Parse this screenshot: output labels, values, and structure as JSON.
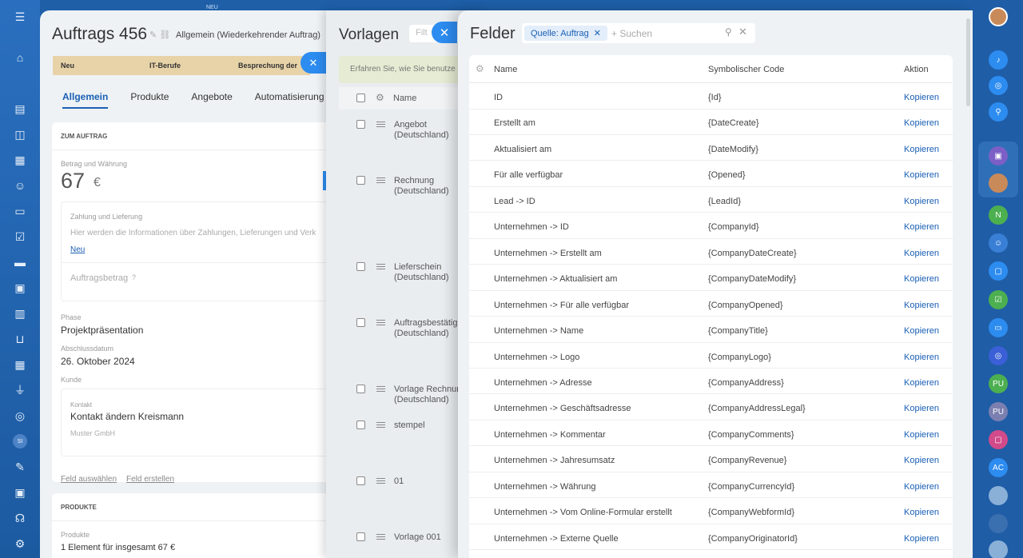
{
  "deal": {
    "title": "Auftrags 456",
    "subtitle": "Allgemein (Wiederkehrender Auftrag)",
    "stages": [
      "Neu",
      "IT-Berufe",
      "Besprechung der"
    ],
    "tabs": [
      "Allgemein",
      "Produkte",
      "Angebote",
      "Automatisierung"
    ],
    "section_title": "ZUM AUFTRAG",
    "amount_label": "Betrag und Währung",
    "amount": "67",
    "currency": "€",
    "payment_title": "Zahlung und Lieferung",
    "payment_text": "Hier werden die Informationen über Zahlungen, Lieferungen und Verk",
    "payment_link": "Neu",
    "order_amount_label": "Auftragsbetrag",
    "phase_label": "Phase",
    "phase_value": "Projektpräsentation",
    "close_date_label": "Abschlussdatum",
    "close_date_value": "26. Oktober 2024",
    "customer_label": "Kunde",
    "contact_label": "Kontakt",
    "contact_value": "Kontakt ändern Kreismann",
    "company_value": "Muster GmbH",
    "select_field": "Feld auswählen",
    "create_field": "Feld erstellen",
    "products_title": "PRODUKTE",
    "products_label": "Produkte",
    "products_value": "1 Element für insgesamt 67 €"
  },
  "templates": {
    "title": "Vorlagen",
    "filter_placeholder": "Filt",
    "info": "Erfahren Sie, wie Sie benutze",
    "name_header": "Name",
    "rows": [
      {
        "name": "Angebot\n(Deutschland)"
      },
      {
        "name": "Rechnung\n(Deutschland)"
      },
      {
        "name": "Lieferschein\n(Deutschland)"
      },
      {
        "name": "Auftragsbestätig\n(Deutschland)"
      },
      {
        "name": "Vorlage Rechnun\n(Deutschland)"
      },
      {
        "name": "stempel"
      },
      {
        "name": "01"
      },
      {
        "name": "Vorlage 001"
      }
    ]
  },
  "fields": {
    "title": "Felder",
    "chip": "Quelle: Auftrag",
    "search_placeholder": "+ Suchen",
    "headers": {
      "name": "Name",
      "code": "Symbolischer Code",
      "action": "Aktion"
    },
    "action_label": "Kopieren",
    "rows": [
      {
        "name": "ID",
        "code": "{Id}"
      },
      {
        "name": "Erstellt am",
        "code": "{DateCreate}"
      },
      {
        "name": "Aktualisiert am",
        "code": "{DateModify}"
      },
      {
        "name": "Für alle verfügbar",
        "code": "{Opened}"
      },
      {
        "name": "Lead -> ID",
        "code": "{LeadId}"
      },
      {
        "name": "Unternehmen -> ID",
        "code": "{CompanyId}"
      },
      {
        "name": "Unternehmen -> Erstellt am",
        "code": "{CompanyDateCreate}"
      },
      {
        "name": "Unternehmen -> Aktualisiert am",
        "code": "{CompanyDateModify}"
      },
      {
        "name": "Unternehmen -> Für alle verfügbar",
        "code": "{CompanyOpened}"
      },
      {
        "name": "Unternehmen -> Name",
        "code": "{CompanyTitle}"
      },
      {
        "name": "Unternehmen -> Logo",
        "code": "{CompanyLogo}"
      },
      {
        "name": "Unternehmen -> Adresse",
        "code": "{CompanyAddress}"
      },
      {
        "name": "Unternehmen -> Geschäftsadresse",
        "code": "{CompanyAddressLegal}"
      },
      {
        "name": "Unternehmen -> Kommentar",
        "code": "{CompanyComments}"
      },
      {
        "name": "Unternehmen -> Jahresumsatz",
        "code": "{CompanyRevenue}"
      },
      {
        "name": "Unternehmen -> Währung",
        "code": "{CompanyCurrencyId}"
      },
      {
        "name": "Unternehmen -> Vom Online-Formular erstellt",
        "code": "{CompanyWebformId}"
      },
      {
        "name": "Unternehmen -> Externe Quelle",
        "code": "{CompanyOriginatorId}"
      }
    ]
  },
  "sidebar": {
    "badge_new": "NEU",
    "avatar_si": "SI",
    "right_items": [
      "N",
      "PU",
      "PU",
      "AC"
    ]
  }
}
